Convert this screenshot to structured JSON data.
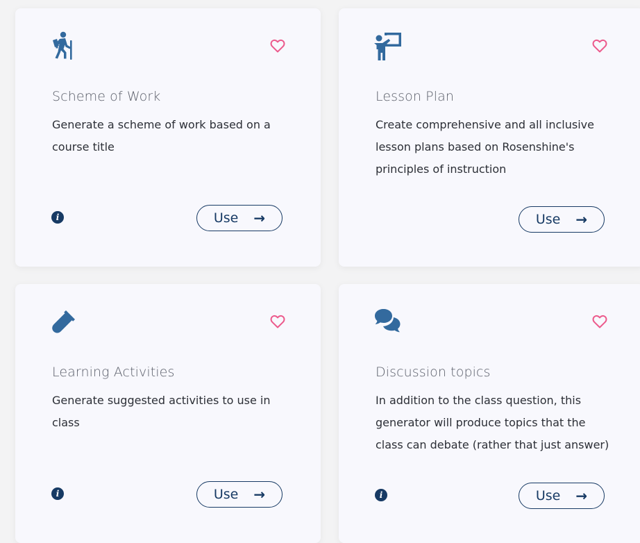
{
  "colors": {
    "card_bg": "#f8f8fd",
    "page_bg": "#f3f3f4",
    "icon_blue": "#336a9e",
    "button_navy": "#173a64",
    "heart_pink": "#ec5a8c",
    "title_gray": "#5b5f6a"
  },
  "cards": [
    {
      "icon": "hiking-person-icon",
      "title": "Scheme of Work",
      "description": "Generate a scheme of work based on a course title",
      "has_info": true,
      "button_label": "Use",
      "button_arrow": "→"
    },
    {
      "icon": "teacher-board-icon",
      "title": "Lesson Plan",
      "description": "Create comprehensive and all inclusive lesson plans based on Rosenshine's principles of instruction",
      "has_info": false,
      "button_label": "Use",
      "button_arrow": "→"
    },
    {
      "icon": "test-tube-icon",
      "title": "Learning Activities",
      "description": "Generate suggested activities to use in class",
      "has_info": true,
      "button_label": "Use",
      "button_arrow": "→"
    },
    {
      "icon": "chat-bubbles-icon",
      "title": "Discussion topics",
      "description": "In addition to the class question, this generator will produce topics that the class can debate (rather that just answer)",
      "has_info": true,
      "button_label": "Use",
      "button_arrow": "→"
    }
  ],
  "info_glyph": "i"
}
